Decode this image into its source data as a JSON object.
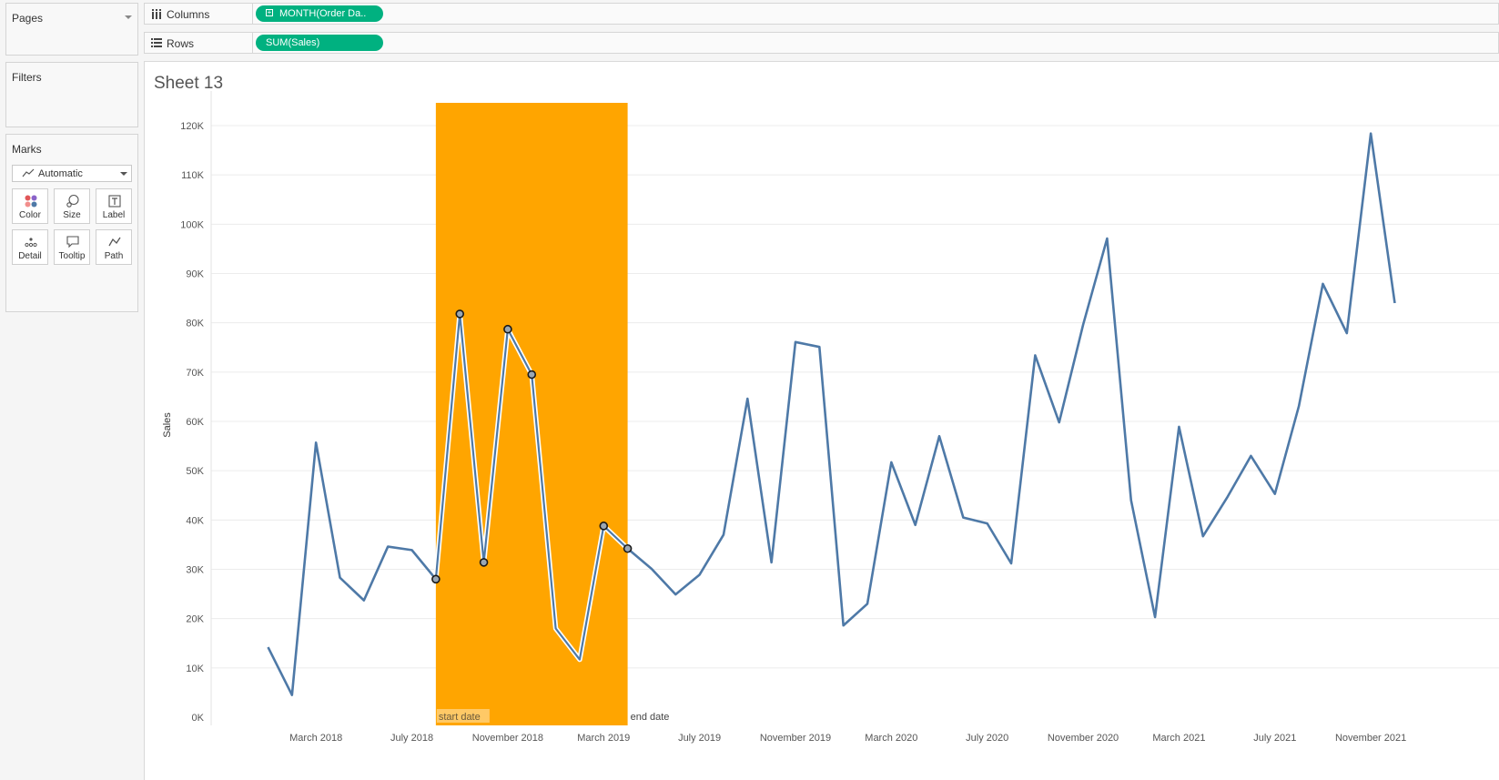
{
  "cards": {
    "pages": {
      "title": "Pages"
    },
    "filters": {
      "title": "Filters"
    },
    "marks": {
      "title": "Marks",
      "mark_type": "Automatic",
      "buttons": [
        {
          "label": "Color",
          "icon": "color-icon"
        },
        {
          "label": "Size",
          "icon": "size-icon"
        },
        {
          "label": "Label",
          "icon": "label-icon"
        },
        {
          "label": "Detail",
          "icon": "detail-icon"
        },
        {
          "label": "Tooltip",
          "icon": "tooltip-icon"
        },
        {
          "label": "Path",
          "icon": "path-icon"
        }
      ]
    }
  },
  "shelves": {
    "columns": {
      "label": "Columns",
      "pill": "MONTH(Order Da..",
      "icon": "columns-icon"
    },
    "rows": {
      "label": "Rows",
      "pill": "SUM(Sales)",
      "icon": "rows-icon"
    }
  },
  "sheet": {
    "title": "Sheet 13"
  },
  "colors": {
    "line": "#4e79a7",
    "highlight_band": "#ffa500",
    "pill": "#00b180",
    "start_label_bg": "#ffc966"
  },
  "chart_data": {
    "type": "line",
    "ylabel": "Sales",
    "xlabel": "",
    "ylim": [
      0,
      120000
    ],
    "yticks": [
      0,
      10000,
      20000,
      30000,
      40000,
      50000,
      60000,
      70000,
      80000,
      90000,
      100000,
      110000,
      120000
    ],
    "ytick_labels": [
      "0K",
      "10K",
      "20K",
      "30K",
      "40K",
      "50K",
      "60K",
      "70K",
      "80K",
      "90K",
      "100K",
      "110K",
      "120K"
    ],
    "grid": true,
    "xtick_labels": [
      {
        "label": "March 2018",
        "x": "2018-03"
      },
      {
        "label": "July 2018",
        "x": "2018-07"
      },
      {
        "label": "November 2018",
        "x": "2018-11"
      },
      {
        "label": "March 2019",
        "x": "2019-03"
      },
      {
        "label": "July 2019",
        "x": "2019-07"
      },
      {
        "label": "November 2019",
        "x": "2019-11"
      },
      {
        "label": "March 2020",
        "x": "2020-03"
      },
      {
        "label": "July 2020",
        "x": "2020-07"
      },
      {
        "label": "November 2020",
        "x": "2020-11"
      },
      {
        "label": "March 2021",
        "x": "2021-03"
      },
      {
        "label": "July 2021",
        "x": "2021-07"
      },
      {
        "label": "November 2021",
        "x": "2021-11"
      }
    ],
    "series": [
      {
        "x": [
          "2018-01",
          "2018-02",
          "2018-03",
          "2018-04",
          "2018-05",
          "2018-06",
          "2018-07",
          "2018-08",
          "2018-09",
          "2018-10",
          "2018-11",
          "2018-12",
          "2019-01",
          "2019-02",
          "2019-03",
          "2019-04",
          "2019-05",
          "2019-06",
          "2019-07",
          "2019-08",
          "2019-09",
          "2019-10",
          "2019-11",
          "2019-12",
          "2020-01",
          "2020-02",
          "2020-03",
          "2020-04",
          "2020-05",
          "2020-06",
          "2020-07",
          "2020-08",
          "2020-09",
          "2020-10",
          "2020-11",
          "2020-12",
          "2021-01",
          "2021-02",
          "2021-03",
          "2021-04",
          "2021-05",
          "2021-06",
          "2021-07",
          "2021-08",
          "2021-09",
          "2021-10",
          "2021-11",
          "2021-12"
        ],
        "values": [
          14200,
          4500,
          55700,
          28300,
          23700,
          34600,
          33900,
          28000,
          81800,
          31400,
          78700,
          69500,
          18000,
          11700,
          38800,
          34200,
          30100,
          24900,
          28900,
          37000,
          64600,
          31400,
          76100,
          75100,
          18600,
          23000,
          51700,
          39000,
          57000,
          40500,
          39300,
          31200,
          73400,
          59800,
          79600,
          97100,
          44000,
          20300,
          58900,
          36700,
          44500,
          53000,
          45300,
          63100,
          87900,
          77900,
          118400,
          84000
        ]
      }
    ],
    "highlight": {
      "start": "2018-08",
      "end": "2019-04",
      "start_label": "start date",
      "end_label": "end date"
    }
  }
}
